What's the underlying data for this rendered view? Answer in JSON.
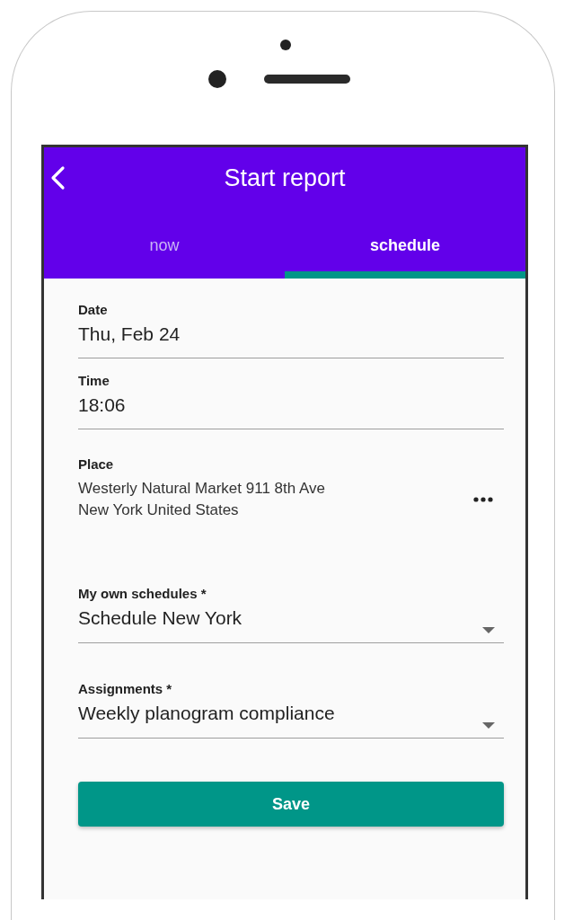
{
  "app_bar": {
    "title": "Start report"
  },
  "tabs": [
    {
      "label": "now",
      "selected": false
    },
    {
      "label": "schedule",
      "selected": true
    }
  ],
  "fields": [
    {
      "kind": "text",
      "label": "Date",
      "value": "Thu, Feb 24"
    },
    {
      "kind": "text",
      "label": "Time",
      "value": "18:06"
    },
    {
      "kind": "place",
      "label": "Place",
      "value": "Westerly Natural Market 911 8th Ave\nNew York United States"
    },
    {
      "kind": "dropdown",
      "label": "My own schedules *",
      "value": "Schedule New York"
    },
    {
      "kind": "dropdown",
      "label": "Assignments *",
      "value": "Weekly planogram compliance"
    }
  ],
  "save_button": {
    "label": "Save"
  }
}
